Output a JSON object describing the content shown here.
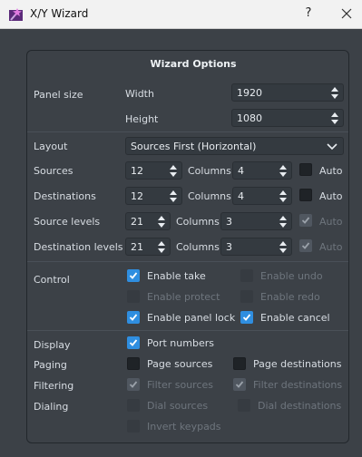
{
  "window": {
    "title": "X/Y Wizard",
    "help": "?",
    "app_icon": "wizard-icon"
  },
  "section_title": "Wizard Options",
  "panel_size": {
    "label": "Panel size",
    "width_label": "Width",
    "width_value": "1920",
    "height_label": "Height",
    "height_value": "1080"
  },
  "layout": {
    "label": "Layout",
    "value": "Sources First (Horizontal)"
  },
  "sources": {
    "label": "Sources",
    "value": "12",
    "columns_label": "Columns",
    "columns_value": "4",
    "auto_label": "Auto",
    "auto_checked": false
  },
  "destinations": {
    "label": "Destinations",
    "value": "12",
    "columns_label": "Columns",
    "columns_value": "4",
    "auto_label": "Auto",
    "auto_checked": false
  },
  "source_levels": {
    "label": "Source levels",
    "value": "21",
    "columns_label": "Columns",
    "columns_value": "3",
    "auto_label": "Auto",
    "auto_checked": true,
    "auto_enabled": false
  },
  "destination_levels": {
    "label": "Destination levels",
    "value": "21",
    "columns_label": "Columns",
    "columns_value": "3",
    "auto_label": "Auto",
    "auto_checked": true,
    "auto_enabled": false
  },
  "control": {
    "label": "Control",
    "enable_take": "Enable take",
    "enable_undo": "Enable undo",
    "enable_protect": "Enable protect",
    "enable_redo": "Enable redo",
    "enable_panel_lock": "Enable panel lock",
    "enable_cancel": "Enable cancel"
  },
  "display": {
    "label": "Display",
    "port_numbers": "Port numbers"
  },
  "paging": {
    "label": "Paging",
    "page_sources": "Page sources",
    "page_destinations": "Page destinations"
  },
  "filtering": {
    "label": "Filtering",
    "filter_sources": "Filter sources",
    "filter_destinations": "Filter destinations"
  },
  "dialing": {
    "label": "Dialing",
    "dial_sources": "Dial sources",
    "dial_destinations": "Dial destinations",
    "invert_keypads": "Invert keypads"
  },
  "colors": {
    "accent": "#2f8ee0",
    "background": "#3c4147",
    "titlebar": "#f2f2f2"
  }
}
